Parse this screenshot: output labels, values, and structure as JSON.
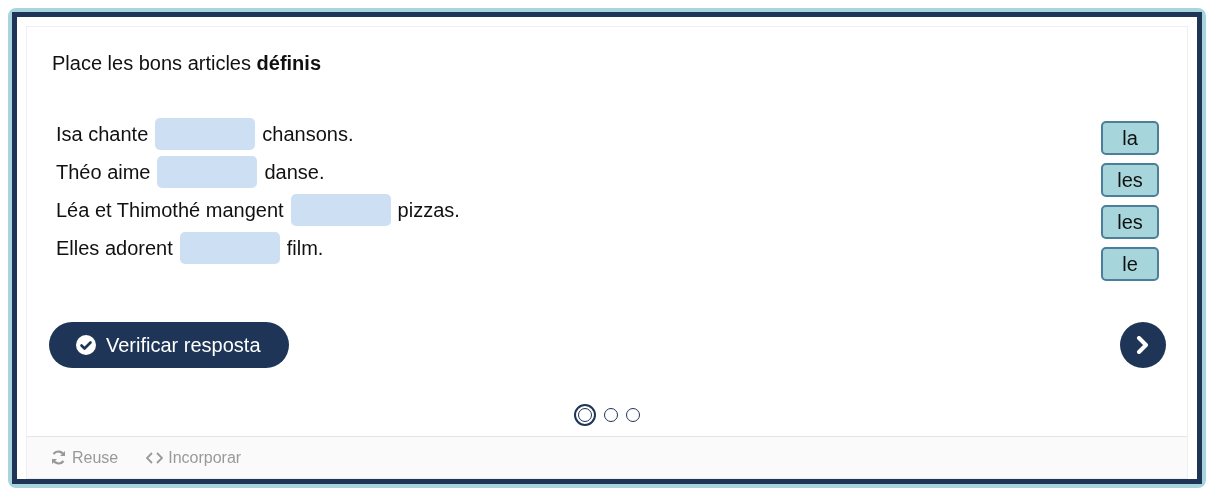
{
  "title": "Place les bons articles **définis**",
  "sentences": [
    {
      "before": "Isa chante",
      "after": "chansons."
    },
    {
      "before": "Théo aime",
      "after": "danse."
    },
    {
      "before": "Léa et Thimothé mangent",
      "after": "pizzas."
    },
    {
      "before": "Elles adorent",
      "after": "film."
    }
  ],
  "words": [
    "la",
    "les",
    "les",
    "le"
  ],
  "check_button": {
    "label": "Verificar resposta"
  },
  "slides": [
    {
      "selected": true
    },
    {
      "selected": false
    },
    {
      "selected": false
    }
  ],
  "footer_links": [
    {
      "label": "Reuse",
      "kind": "reuse"
    },
    {
      "label": "Incorporar",
      "kind": "embed"
    }
  ]
}
